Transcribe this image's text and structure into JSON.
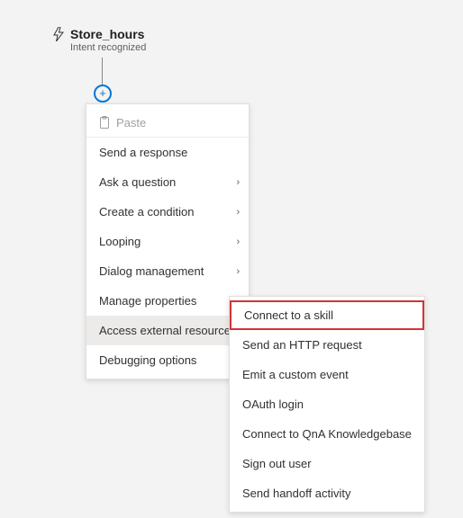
{
  "trigger": {
    "title": "Store_hours",
    "subtitle": "Intent recognized"
  },
  "primaryMenu": {
    "paste": "Paste",
    "items": [
      {
        "label": "Send a response",
        "submenu": false
      },
      {
        "label": "Ask a question",
        "submenu": true
      },
      {
        "label": "Create a condition",
        "submenu": true
      },
      {
        "label": "Looping",
        "submenu": true
      },
      {
        "label": "Dialog management",
        "submenu": true
      },
      {
        "label": "Manage properties",
        "submenu": true
      },
      {
        "label": "Access external resources",
        "submenu": true,
        "hovered": true
      },
      {
        "label": "Debugging options",
        "submenu": true
      }
    ]
  },
  "secondaryMenu": {
    "items": [
      {
        "label": "Connect to a skill",
        "highlighted": true
      },
      {
        "label": "Send an HTTP request"
      },
      {
        "label": "Emit a custom event"
      },
      {
        "label": "OAuth login"
      },
      {
        "label": "Connect to QnA Knowledgebase"
      },
      {
        "label": "Sign out user"
      },
      {
        "label": "Send handoff activity"
      }
    ]
  }
}
